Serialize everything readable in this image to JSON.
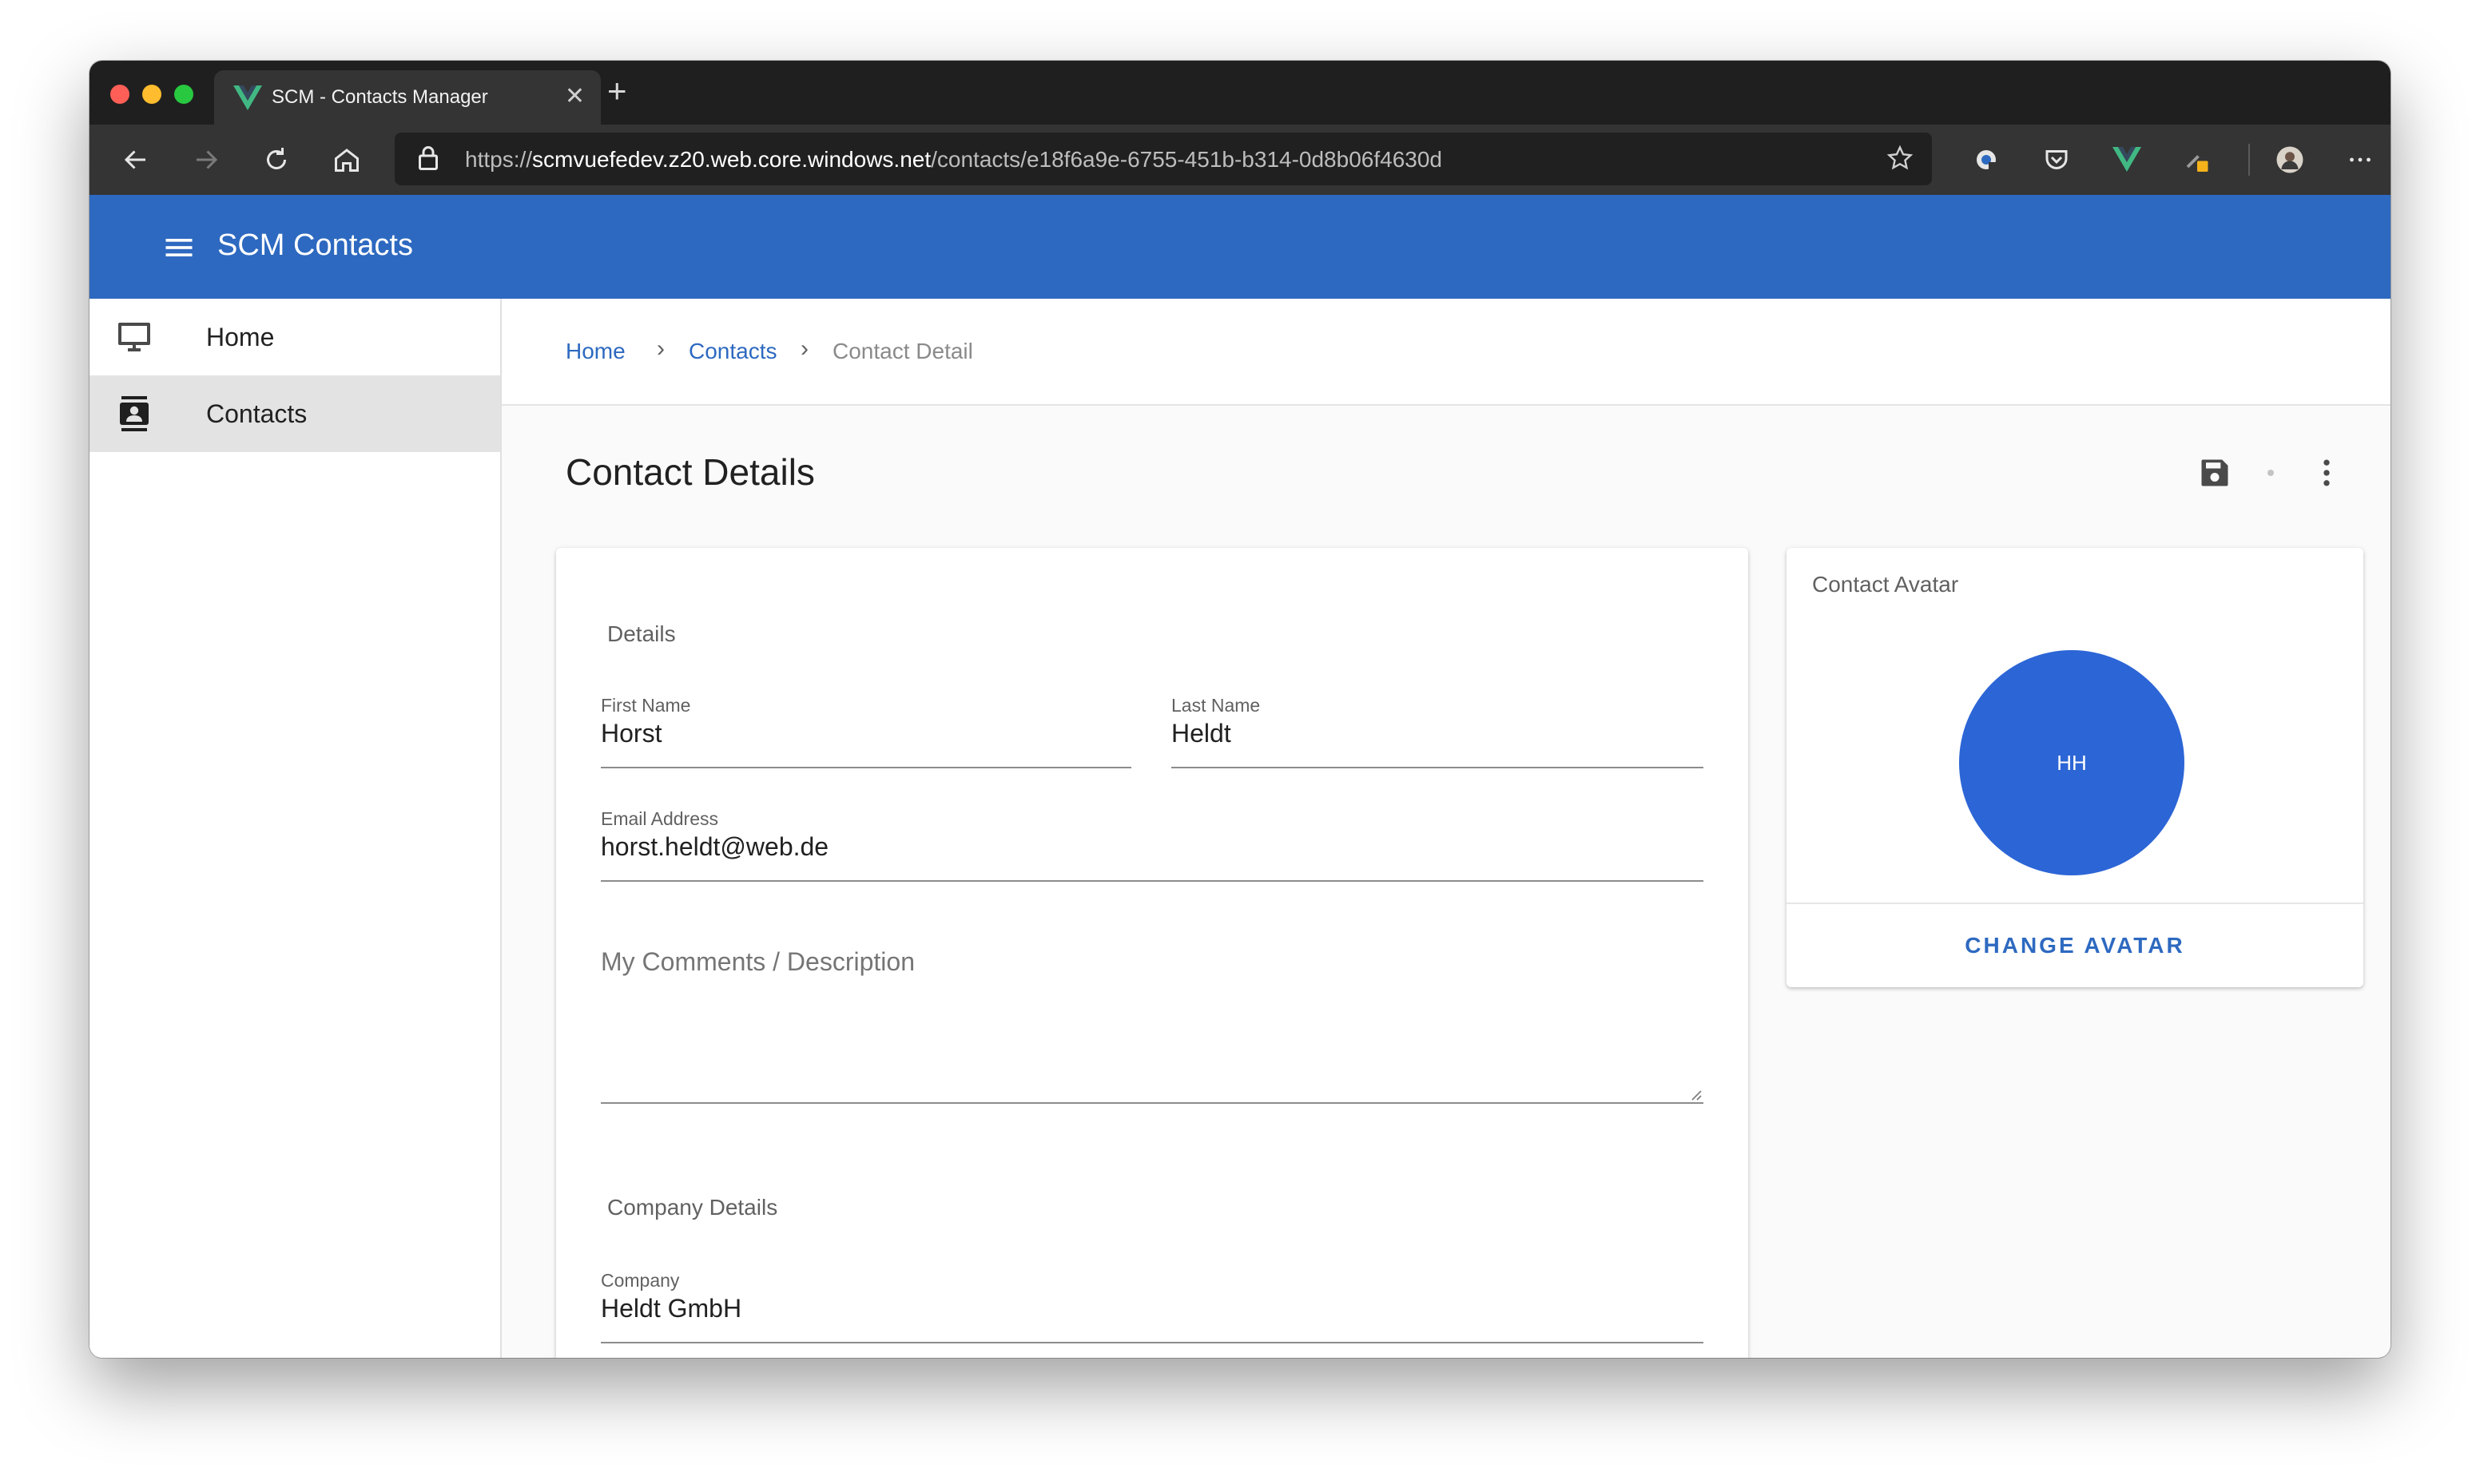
{
  "browser": {
    "tab": {
      "title": "SCM - Contacts Manager",
      "favicon": "vue-logo-icon"
    },
    "address": {
      "scheme": "https://",
      "host": "scmvuefedev.z20.web.core.windows.net",
      "path": "/contacts/e18f6a9e-6755-451b-b314-0d8b06f4630d"
    },
    "toolbar_icons": [
      "back-arrow-icon",
      "forward-arrow-icon",
      "refresh-icon",
      "home-icon",
      "lock-icon",
      "star-icon",
      "extension-globe-icon",
      "pocket-icon",
      "vue-devtools-icon",
      "extension-pen-icon",
      "profile-avatar",
      "more-icon"
    ]
  },
  "app": {
    "title": "SCM Contacts",
    "brand_color": "#2d69c0"
  },
  "sidebar": {
    "items": [
      {
        "label": "Home",
        "icon": "monitor-icon",
        "active": false
      },
      {
        "label": "Contacts",
        "icon": "contacts-icon",
        "active": true
      }
    ]
  },
  "breadcrumb": {
    "items": [
      "Home",
      "Contacts",
      "Contact Detail"
    ],
    "separator": "›"
  },
  "page": {
    "title": "Contact Details",
    "actions": [
      "save-icon",
      "dot-icon",
      "more-vertical-icon"
    ]
  },
  "details_card": {
    "section_title": "Details",
    "first_name": {
      "label": "First Name",
      "value": "Horst"
    },
    "last_name": {
      "label": "Last Name",
      "value": "Heldt"
    },
    "email": {
      "label": "Email Address",
      "value": "horst.heldt@web.de"
    },
    "comments": {
      "label": "My Comments / Description",
      "value": ""
    },
    "company_section_title": "Company Details",
    "company": {
      "label": "Company",
      "value": "Heldt GmbH"
    }
  },
  "avatar_card": {
    "title": "Contact Avatar",
    "initials": "HH",
    "avatar_color": "#2c65d6",
    "button_label": "CHANGE AVATAR"
  }
}
